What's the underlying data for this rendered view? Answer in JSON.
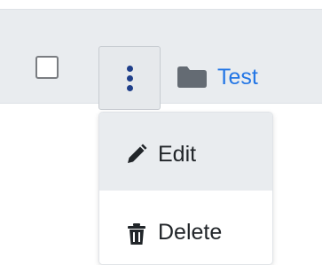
{
  "row": {
    "name": "Test",
    "selected": false,
    "icon": "folder-icon",
    "link_color": "#2376e5"
  },
  "actions_button": {
    "icon": "kebab-vertical-icon",
    "icon_color": "#1f3f8a"
  },
  "menu": {
    "items": [
      {
        "label": "Edit",
        "icon": "pencil-icon",
        "highlighted": true
      },
      {
        "label": "Delete",
        "icon": "trash-icon",
        "highlighted": false
      }
    ]
  }
}
